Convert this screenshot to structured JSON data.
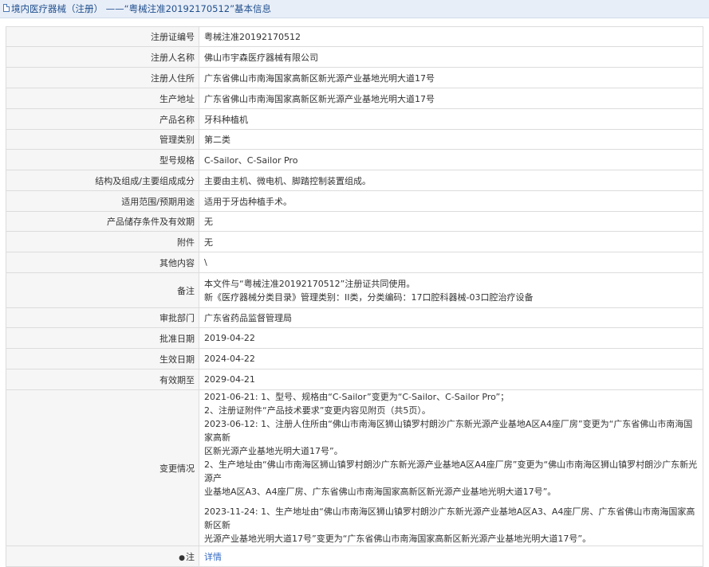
{
  "header": {
    "title": "境内医疗器械（注册） ——“粤械注准20192170512”基本信息"
  },
  "rows": [
    {
      "label": "注册证编号",
      "value": "粤械注准20192170512"
    },
    {
      "label": "注册人名称",
      "value": "佛山市宇森医疗器械有限公司"
    },
    {
      "label": "注册人住所",
      "value": "广东省佛山市南海国家高新区新光源产业基地光明大道17号"
    },
    {
      "label": "生产地址",
      "value": "广东省佛山市南海国家高新区新光源产业基地光明大道17号"
    },
    {
      "label": "产品名称",
      "value": "牙科种植机"
    },
    {
      "label": "管理类别",
      "value": "第二类"
    },
    {
      "label": "型号规格",
      "value": "C-Sailor、C-Sailor Pro"
    },
    {
      "label": "结构及组成/主要组成成分",
      "value": "主要由主机、微电机、脚踏控制装置组成。"
    },
    {
      "label": "适用范围/预期用途",
      "value": "适用于牙齿种植手术。"
    },
    {
      "label": "产品储存条件及有效期",
      "value": "无"
    },
    {
      "label": "附件",
      "value": "无"
    },
    {
      "label": "其他内容",
      "value": "\\"
    }
  ],
  "remark": {
    "label": "备注",
    "lines": [
      "本文件与“粤械注准20192170512”注册证共同使用。",
      "新《医疗器械分类目录》管理类别：II类，分类编码：17口腔科器械-03口腔治疗设备"
    ]
  },
  "rows2": [
    {
      "label": "审批部门",
      "value": "广东省药品监督管理局"
    },
    {
      "label": "批准日期",
      "value": "2019-04-22"
    },
    {
      "label": "生效日期",
      "value": "2024-04-22"
    },
    {
      "label": "有效期至",
      "value": "2029-04-21"
    }
  ],
  "changes": {
    "label": "变更情况",
    "l1": "2021-06-21: 1、型号、规格由“C-Sailor”变更为“C-Sailor、C-Sailor Pro”；",
    "l2": "2、注册证附件“产品技术要求”变更内容见附页（共5页）。",
    "l3": "2023-06-12: 1、注册人住所由“佛山市南海区狮山镇罗村朗沙广东新光源产业基地A区A4座厂房”变更为“广东省佛山市南海国家高新",
    "l4": "区新光源产业基地光明大道17号”。",
    "l5": "2、生产地址由“佛山市南海区狮山镇罗村朗沙广东新光源产业基地A区A4座厂房”变更为“佛山市南海区狮山镇罗村朗沙广东新光源产",
    "l6": "业基地A区A3、A4座厂房、广东省佛山市南海国家高新区新光源产业基地光明大道17号”。",
    "l7": "2023-11-24: 1、生产地址由“佛山市南海区狮山镇罗村朗沙广东新光源产业基地A区A3、A4座厂房、广东省佛山市南海国家高新区新",
    "l8": "光源产业基地光明大道17号”变更为“广东省佛山市南海国家高新区新光源产业基地光明大道17号”。"
  },
  "note": {
    "label": "注",
    "link": "详情"
  }
}
